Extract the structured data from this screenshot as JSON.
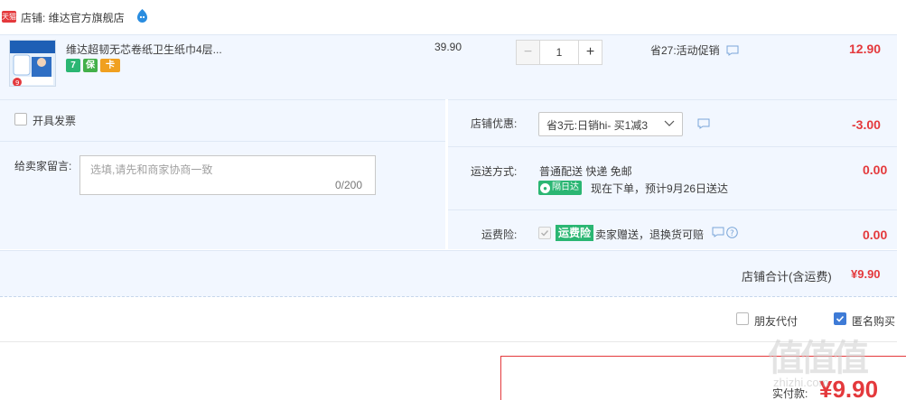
{
  "shop": {
    "badge": "天猫",
    "label": "店铺: 维达官方旗舰店"
  },
  "item": {
    "title": "维达超韧无芯卷纸卫生纸巾4层...",
    "price": "39.90",
    "quantity": "1",
    "promo": "省27:活动促销",
    "subtotal": "12.90",
    "service_icons": [
      "7",
      "保",
      "卡"
    ]
  },
  "invoice": {
    "label": "开具发票"
  },
  "message": {
    "label": "给卖家留言:",
    "placeholder": "选填,请先和商家协商一致",
    "count": "0/200"
  },
  "coupon": {
    "label": "店铺优惠:",
    "selected": "省3元:日销hi- 买1减3",
    "value": "-3.00"
  },
  "shipping": {
    "label": "运送方式:",
    "method": "普通配送 快递 免邮",
    "badge": "隔日达",
    "eta": "现在下单，预计9月26日送达",
    "value": "0.00"
  },
  "insurance": {
    "label": "运费险:",
    "tag": "运费险",
    "text": "卖家赠送，退换货可赔",
    "value": "0.00"
  },
  "total": {
    "label": "店铺合计(含运费)",
    "value": "¥9.90"
  },
  "options": {
    "friend_pay": "朋友代付",
    "anonymous": "匿名购买"
  },
  "payment": {
    "label": "实付款:",
    "value": "¥9.90"
  },
  "watermark": {
    "mark": "值值值",
    "url": "zhizhi.com"
  },
  "colors": {
    "price_red": "#e4393c",
    "panel_blue": "#f2f7ff",
    "green_badge": "#2bb673",
    "check_blue": "#3e7bd6"
  }
}
